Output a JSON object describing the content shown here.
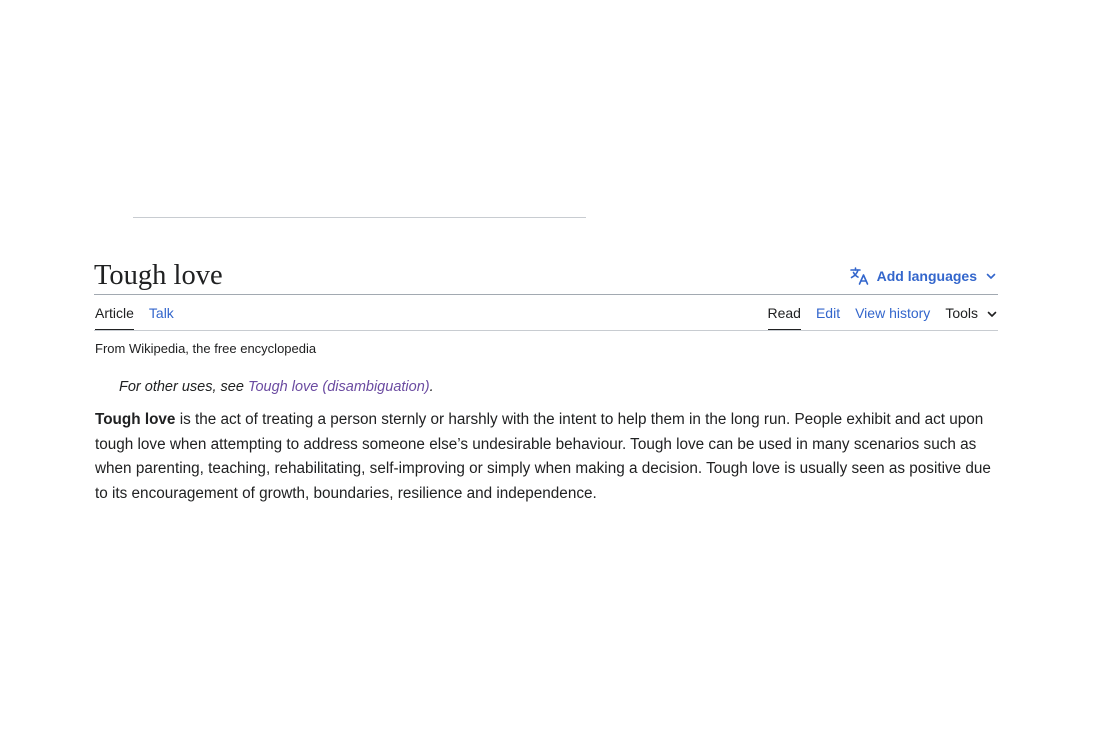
{
  "article": {
    "title": "Tough love",
    "add_languages_label": "Add languages",
    "tagline": "From Wikipedia, the free encyclopedia"
  },
  "tabs": {
    "left": [
      {
        "label": "Article",
        "selected": true
      },
      {
        "label": "Talk",
        "selected": false
      }
    ],
    "right": [
      {
        "label": "Read",
        "selected": true
      },
      {
        "label": "Edit",
        "selected": false
      },
      {
        "label": "View history",
        "selected": false
      }
    ],
    "tools_label": "Tools"
  },
  "hatnote": {
    "prefix": "For other uses, see ",
    "link_text": "Tough love (disambiguation)",
    "suffix": "."
  },
  "lead": {
    "bold_term": "Tough love",
    "text": " is the act of treating a person sternly or harshly with the intent to help them in the long run. People exhibit and act upon tough love when attempting to address someone else’s undesirable behaviour. Tough love can be used in many scenarios such as when parenting, teaching, rehabilitating, self-improving or simply when making a decision. Tough love is usually seen as positive due to its encouragement of growth, boundaries, resilience and independence."
  },
  "icons": {
    "language": "translate-icon",
    "chevron": "chevron-down-icon"
  },
  "colors": {
    "link": "#3366cc",
    "visited_link": "#6b4ba1",
    "text": "#202122"
  }
}
